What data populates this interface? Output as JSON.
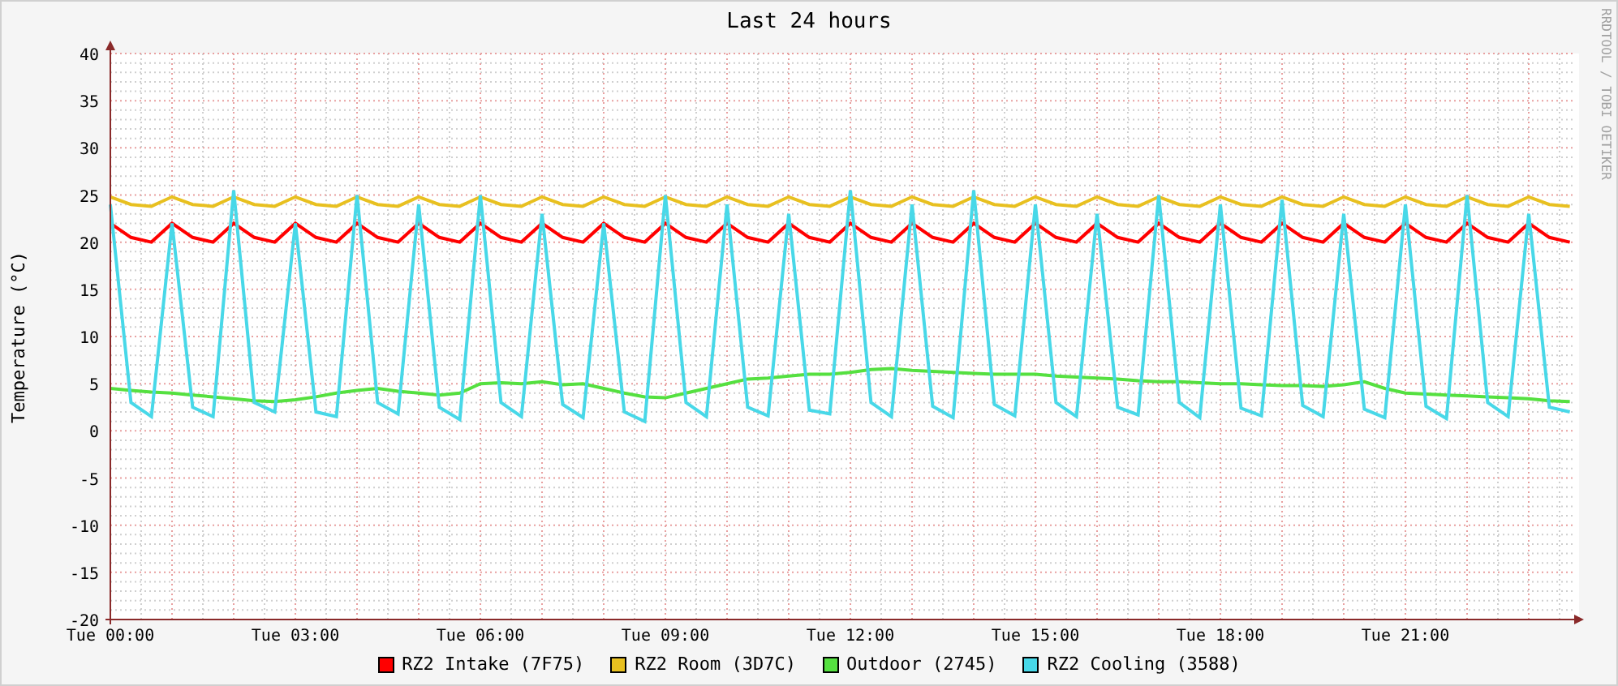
{
  "side_text": "RRDTOOL / TOBI OETIKER",
  "chart": {
    "chart_data": {
      "type": "line",
      "title": "Last 24 hours",
      "ylabel": "Temperature (°C)",
      "categories": [
        "Tue 00:00",
        null,
        null,
        null,
        null,
        null,
        null,
        null,
        null,
        "Tue 03:00",
        null,
        null,
        null,
        null,
        null,
        null,
        null,
        null,
        "Tue 06:00",
        null,
        null,
        null,
        null,
        null,
        null,
        null,
        null,
        "Tue 09:00",
        null,
        null,
        null,
        null,
        null,
        null,
        null,
        null,
        "Tue 12:00",
        null,
        null,
        null,
        null,
        null,
        null,
        null,
        null,
        "Tue 15:00",
        null,
        null,
        null,
        null,
        null,
        null,
        null,
        null,
        "Tue 18:00",
        null,
        null,
        null,
        null,
        null,
        null,
        null,
        null,
        "Tue 21:00",
        null,
        null,
        null,
        null,
        null,
        null,
        null,
        null
      ],
      "ylim": [
        -20,
        40
      ],
      "grid": true,
      "yticks": [
        40,
        35,
        30,
        25,
        20,
        15,
        10,
        5,
        0,
        -5,
        -10,
        -15,
        -20
      ],
      "series": [
        {
          "name": "RZ2 Intake (7F75)",
          "color": "#ff0000",
          "values": [
            22,
            20.5,
            20,
            22,
            20.5,
            20,
            22,
            20.5,
            20,
            22,
            20.5,
            20,
            22,
            20.5,
            20,
            22,
            20.5,
            20,
            22,
            20.5,
            20,
            22,
            20.5,
            20,
            22,
            20.5,
            20,
            22,
            20.5,
            20,
            22,
            20.5,
            20,
            22,
            20.5,
            20,
            22,
            20.5,
            20,
            22,
            20.5,
            20,
            22,
            20.5,
            20,
            22,
            20.5,
            20,
            22,
            20.5,
            20,
            22,
            20.5,
            20,
            22,
            20.5,
            20,
            22,
            20.5,
            20,
            22,
            20.5,
            20,
            22,
            20.5,
            20,
            22,
            20.5,
            20,
            22,
            20.5,
            20
          ]
        },
        {
          "name": "RZ2 Room (3D7C)",
          "color": "#e8c020",
          "values": [
            24.8,
            24,
            23.8,
            24.8,
            24,
            23.8,
            24.8,
            24,
            23.8,
            24.8,
            24,
            23.8,
            24.8,
            24,
            23.8,
            24.8,
            24,
            23.8,
            24.8,
            24,
            23.8,
            24.8,
            24,
            23.8,
            24.8,
            24,
            23.8,
            24.8,
            24,
            23.8,
            24.8,
            24,
            23.8,
            24.8,
            24,
            23.8,
            24.8,
            24,
            23.8,
            24.8,
            24,
            23.8,
            24.8,
            24,
            23.8,
            24.8,
            24,
            23.8,
            24.8,
            24,
            23.8,
            24.8,
            24,
            23.8,
            24.8,
            24,
            23.8,
            24.8,
            24,
            23.8,
            24.8,
            24,
            23.8,
            24.8,
            24,
            23.8,
            24.8,
            24,
            23.8,
            24.8,
            24,
            23.8
          ]
        },
        {
          "name": "Outdoor (2745)",
          "color": "#55e040",
          "values": [
            4.5,
            4.3,
            4.1,
            4,
            3.8,
            3.6,
            3.4,
            3.2,
            3.1,
            3.3,
            3.6,
            4,
            4.3,
            4.5,
            4.2,
            4,
            3.8,
            4,
            5,
            5.1,
            5,
            5.2,
            4.9,
            5,
            4.5,
            4,
            3.6,
            3.5,
            4,
            4.5,
            5,
            5.5,
            5.6,
            5.8,
            6,
            6,
            6.2,
            6.5,
            6.6,
            6.4,
            6.3,
            6.2,
            6.1,
            6,
            6,
            6,
            5.8,
            5.7,
            5.6,
            5.5,
            5.3,
            5.2,
            5.2,
            5.1,
            5,
            5,
            4.9,
            4.8,
            4.8,
            4.7,
            4.9,
            5.2,
            4.5,
            4,
            3.9,
            3.8,
            3.7,
            3.6,
            3.5,
            3.4,
            3.2,
            3.1
          ]
        },
        {
          "name": "RZ2 Cooling (3588)",
          "color": "#48d8e8",
          "values": [
            24,
            3,
            1.5,
            22,
            2.5,
            1.5,
            25.5,
            3,
            2,
            22,
            2,
            1.5,
            25,
            3,
            1.8,
            24,
            2.5,
            1.2,
            25,
            3,
            1.5,
            23,
            2.8,
            1.4,
            22,
            2,
            1,
            25,
            3,
            1.5,
            24,
            2.5,
            1.6,
            23,
            2.2,
            1.8,
            25.5,
            3,
            1.5,
            24,
            2.6,
            1.4,
            25.5,
            2.8,
            1.6,
            24,
            3,
            1.5,
            23,
            2.5,
            1.7,
            25,
            3,
            1.4,
            24,
            2.4,
            1.6,
            24.5,
            2.7,
            1.5,
            23,
            2.3,
            1.4,
            24,
            2.6,
            1.3,
            25,
            3,
            1.5,
            23,
            2.5,
            2
          ]
        }
      ]
    }
  }
}
